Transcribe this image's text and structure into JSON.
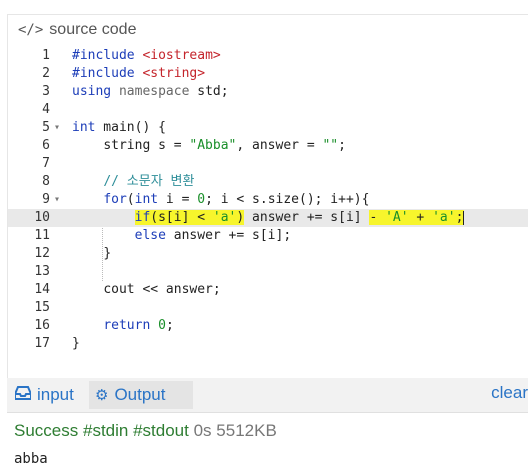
{
  "header": {
    "icon": "code-icon",
    "icon_glyph": "</>",
    "title": "source code"
  },
  "code": {
    "line_numbers": [
      "1",
      "2",
      "3",
      "4",
      "5",
      "6",
      "7",
      "8",
      "9",
      "10",
      "11",
      "12",
      "13",
      "14",
      "15",
      "16",
      "17"
    ],
    "l1_a": "#include",
    "l1_b": "<iostream>",
    "l2_a": "#include",
    "l2_b": "<string>",
    "l3_a": "using",
    "l3_b": "namespace",
    "l3_c": "std;",
    "l5_a": "int",
    "l5_b": " main() {",
    "l6_a": "string s = ",
    "l6_b": "\"Abba\"",
    "l6_c": ", answer = ",
    "l6_d": "\"\"",
    "l6_e": ";",
    "l8": "// 소문자 변환",
    "l9_a": "for",
    "l9_b": "(",
    "l9_c": "int",
    "l9_d": " i = ",
    "l9_e": "0",
    "l9_f": "; i < s.size(); i++){",
    "l10_a": "if",
    "l10_b": "(s[i] < ",
    "l10_c": "'a'",
    "l10_d": ")",
    "l10_e": " answer += s[i] ",
    "l10_f": "- ",
    "l10_g": "'A'",
    "l10_h": " + ",
    "l10_i": "'a'",
    "l10_j": ";",
    "l11_a": "else",
    "l11_b": " answer += s[i];",
    "l12": "}",
    "l14": "cout << answer;",
    "l16_a": "return",
    "l16_b": " 0",
    "l16_c": ";",
    "l17": "}"
  },
  "tabs": {
    "input_label": "input",
    "input_icon": "inbox-icon",
    "output_label": "Output",
    "output_icon": "gears-icon",
    "clear_label": "clear"
  },
  "result": {
    "status": "Success",
    "stdin": "#stdin",
    "stdout_tag": "#stdout",
    "time": "0s",
    "memory": "5512KB",
    "output": "abba"
  },
  "colors": {
    "accent": "#2a74c6",
    "success": "#2e7d32",
    "highlight": "#f7f52c"
  }
}
